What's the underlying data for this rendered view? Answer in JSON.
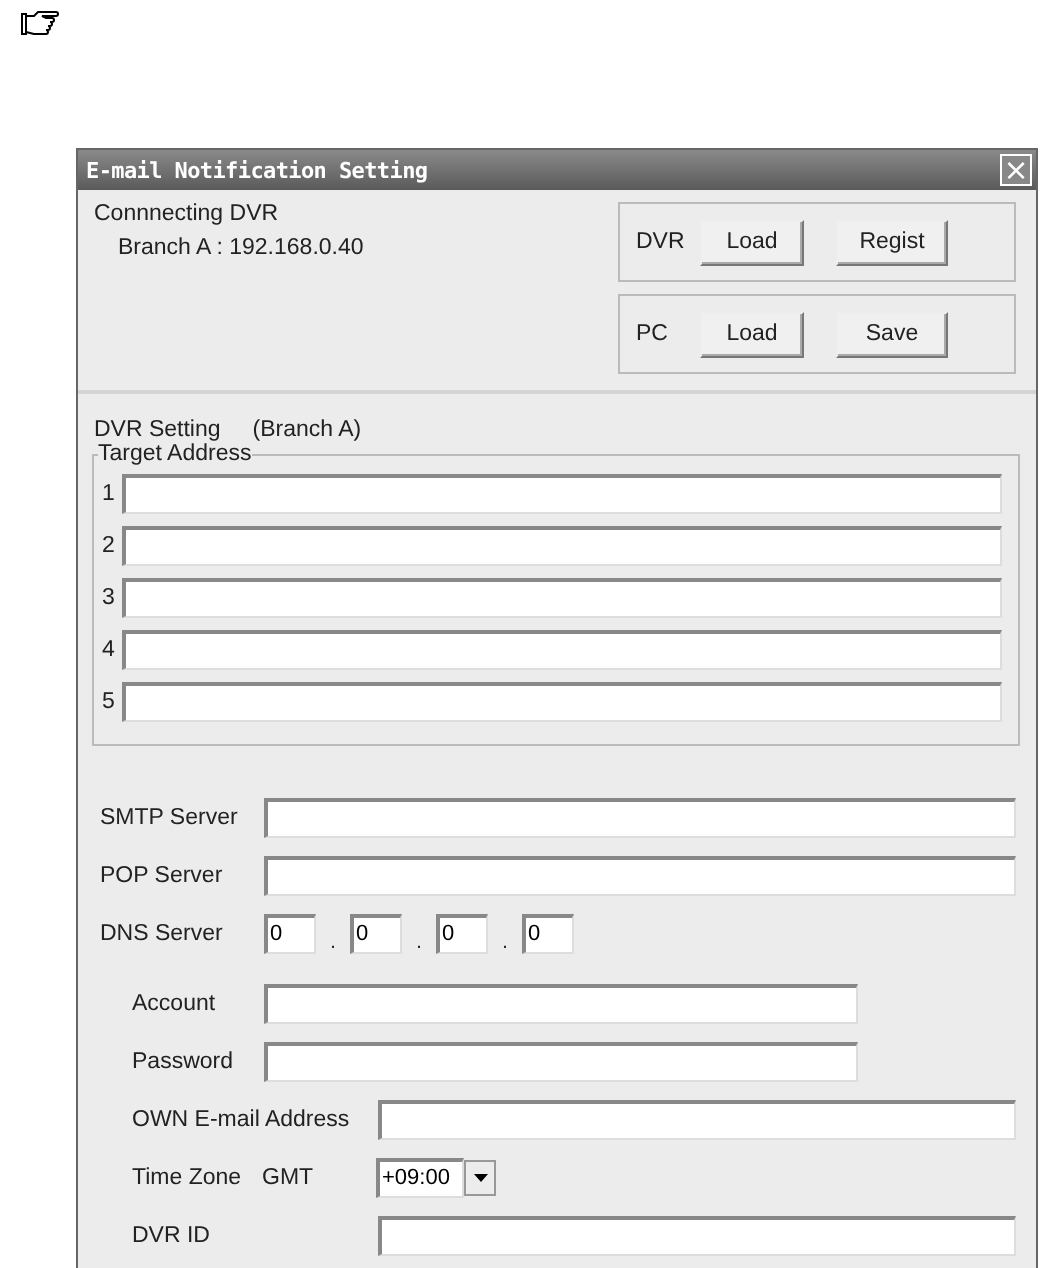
{
  "window": {
    "title": "E-mail Notification Setting",
    "close": "×"
  },
  "connecting": {
    "label": "Connnecting DVR",
    "value": "Branch A : 192.168.0.40"
  },
  "button_groups": [
    {
      "label": "DVR",
      "buttons": [
        "Load",
        "Regist"
      ]
    },
    {
      "label": "PC",
      "buttons": [
        "Load",
        "Save"
      ]
    }
  ],
  "dvr_setting": {
    "label": "DVR Setting",
    "target": "(Branch A)"
  },
  "target_address": {
    "legend": "Target Address",
    "rows": [
      {
        "number": "1"
      },
      {
        "number": "2"
      },
      {
        "number": "3"
      },
      {
        "number": "4"
      },
      {
        "number": "5"
      }
    ]
  },
  "servers": [
    {
      "label": "SMTP Server"
    },
    {
      "label": "POP Server"
    }
  ],
  "dns": {
    "label": "DNS Server",
    "octets": [
      "0",
      "0",
      "0",
      "0"
    ],
    "separators": [
      ".",
      ".",
      "."
    ]
  },
  "credentials": [
    {
      "label": "Account"
    },
    {
      "label": "Password"
    }
  ],
  "own_email": {
    "label": "OWN E-mail Address"
  },
  "time_zone": {
    "label": "Time Zone",
    "prefix": "GMT",
    "value": "+09:00"
  },
  "dvr_id": {
    "label": "DVR ID"
  }
}
